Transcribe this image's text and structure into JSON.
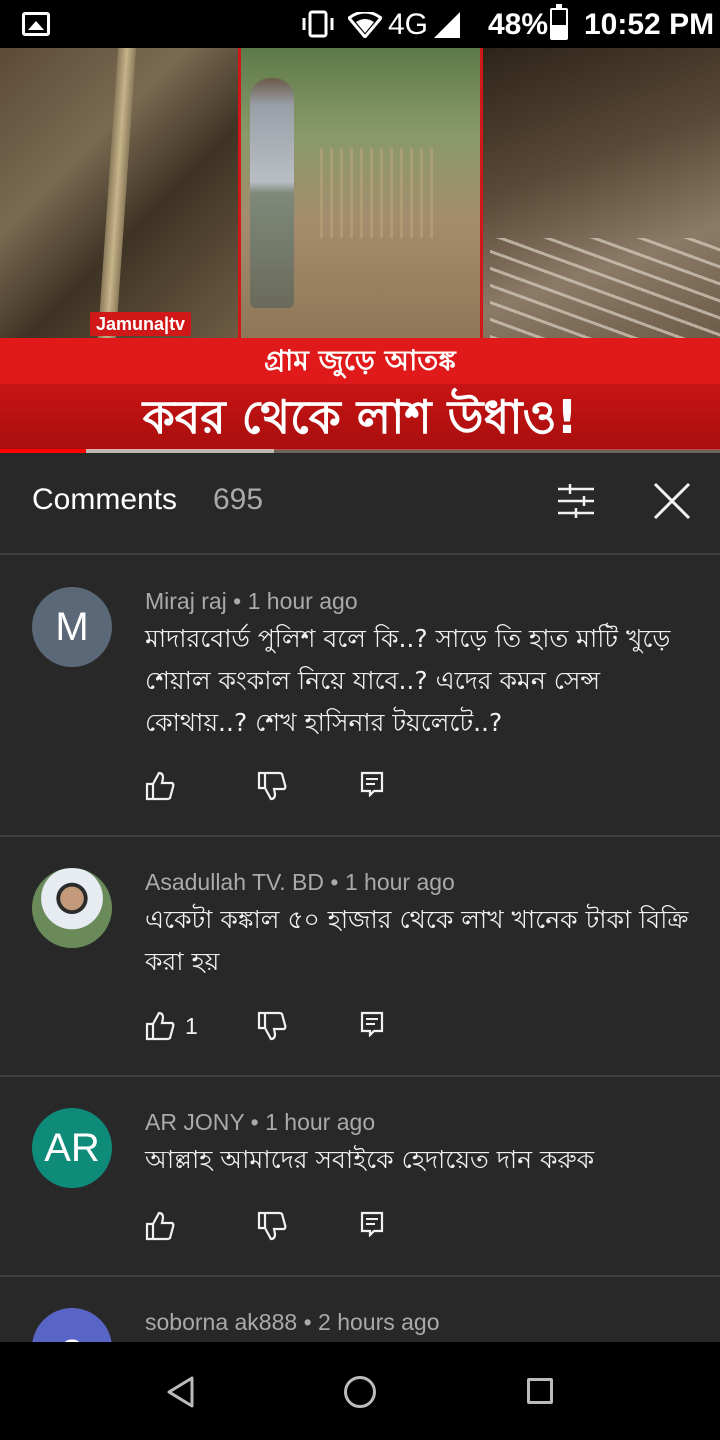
{
  "status_bar": {
    "network": "4G",
    "battery_percent": "48%",
    "battery_level": 0.48,
    "time": "10:52 PM",
    "icons": [
      "gallery-icon",
      "vibrate-icon",
      "wifi-icon",
      "signal-icon",
      "battery-icon"
    ]
  },
  "video": {
    "channel_logo": "Jamuna|tv",
    "headline_small": "গ্রাম জুড়ে আতঙ্ক",
    "headline_big": "কবর থেকে লাশ উধাও!",
    "progress_played": 0.12,
    "progress_buffered": 0.38
  },
  "comments_header": {
    "title": "Comments",
    "count": "695"
  },
  "comments": [
    {
      "avatar_letter": "M",
      "avatar_color": "#5b6878",
      "author": "Miraj raj",
      "time": "1 hour ago",
      "text": "মাদারবোর্ড পুলিশ বলে কি..? সাড়ে তি হাত মাটি খুড়ে শেয়াল কংকাল নিয়ে যাবে..?  এদের কমন সেন্স কোথায়..?  শেখ হাসিনার টয়লেটে..?",
      "likes": ""
    },
    {
      "avatar_letter": "",
      "avatar_color": "#6a8a5a",
      "author": "Asadullah TV. BD",
      "time": "1 hour ago",
      "text": "একেটা কঙ্কাল ৫০ হাজার থেকে লাখ খানেক টাকা বিক্রি করা হয়",
      "likes": "1"
    },
    {
      "avatar_letter": "AR",
      "avatar_color": "#0f8b7a",
      "author": "AR JONY",
      "time": "1 hour ago",
      "text": "আল্লাহ আমাদের সবাইকে হেদায়েত দান করুক",
      "likes": ""
    },
    {
      "avatar_letter": "s",
      "avatar_color": "#5865c6",
      "author": "soborna ak888",
      "time": "2 hours ago",
      "text": "",
      "likes": ""
    }
  ],
  "colors": {
    "accent_red": "#e01a1a",
    "background": "#282828"
  }
}
